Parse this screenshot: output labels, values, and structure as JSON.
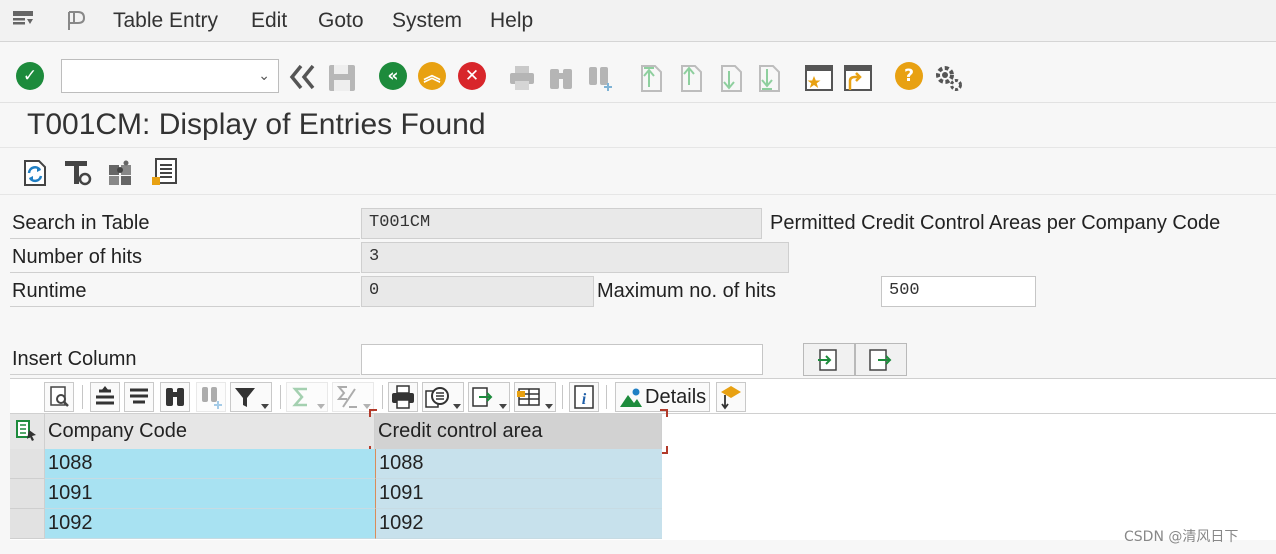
{
  "menu": {
    "items": [
      "Table Entry",
      "Edit",
      "Goto",
      "System",
      "Help"
    ]
  },
  "toolbar": {
    "command_value": "",
    "icons": [
      "check-icon",
      "double-back-icon",
      "save-icon",
      "back-icon",
      "exit-icon",
      "cancel-icon",
      "print-icon",
      "find-icon",
      "find-next-icon",
      "first-page-icon",
      "previous-page-icon",
      "next-page-icon",
      "last-page-icon",
      "create-session-icon",
      "shortcut-icon",
      "help-icon",
      "settings-icon"
    ]
  },
  "title": "T001CM: Display of Entries Found",
  "app_toolbar": {
    "icons": [
      "refresh-icon",
      "table-settings-icon",
      "puzzle-icon",
      "list-icon"
    ]
  },
  "form": {
    "search_label": "Search in Table",
    "search_value": "T001CM",
    "search_desc": "Permitted Credit Control Areas per Company Code",
    "hits_label": "Number of hits",
    "hits_value": "3",
    "runtime_label": "Runtime",
    "runtime_value": "0",
    "max_hits_label": "Maximum no. of hits",
    "max_hits_value": "500",
    "insert_label": "Insert Column",
    "insert_value": ""
  },
  "grid_toolbar": {
    "details_label": "Details"
  },
  "grid": {
    "columns": [
      "Company Code",
      "Credit control area"
    ],
    "rows": [
      [
        "1088",
        "1088"
      ],
      [
        "1091",
        "1091"
      ],
      [
        "1092",
        "1092"
      ]
    ]
  },
  "colors": {
    "key_column_bg": "#a8e2f2",
    "data_column_bg": "#c7e1ec",
    "selected_header_bg": "#d2d2d2",
    "selection_marker": "#b23a2a",
    "ok_green": "#1d8b3c",
    "back_green": "#1d8b3c",
    "exit_orange": "#e8a112",
    "cancel_red": "#d8262b",
    "help_orange": "#e8a112"
  },
  "watermark": "CSDN @清风日下"
}
